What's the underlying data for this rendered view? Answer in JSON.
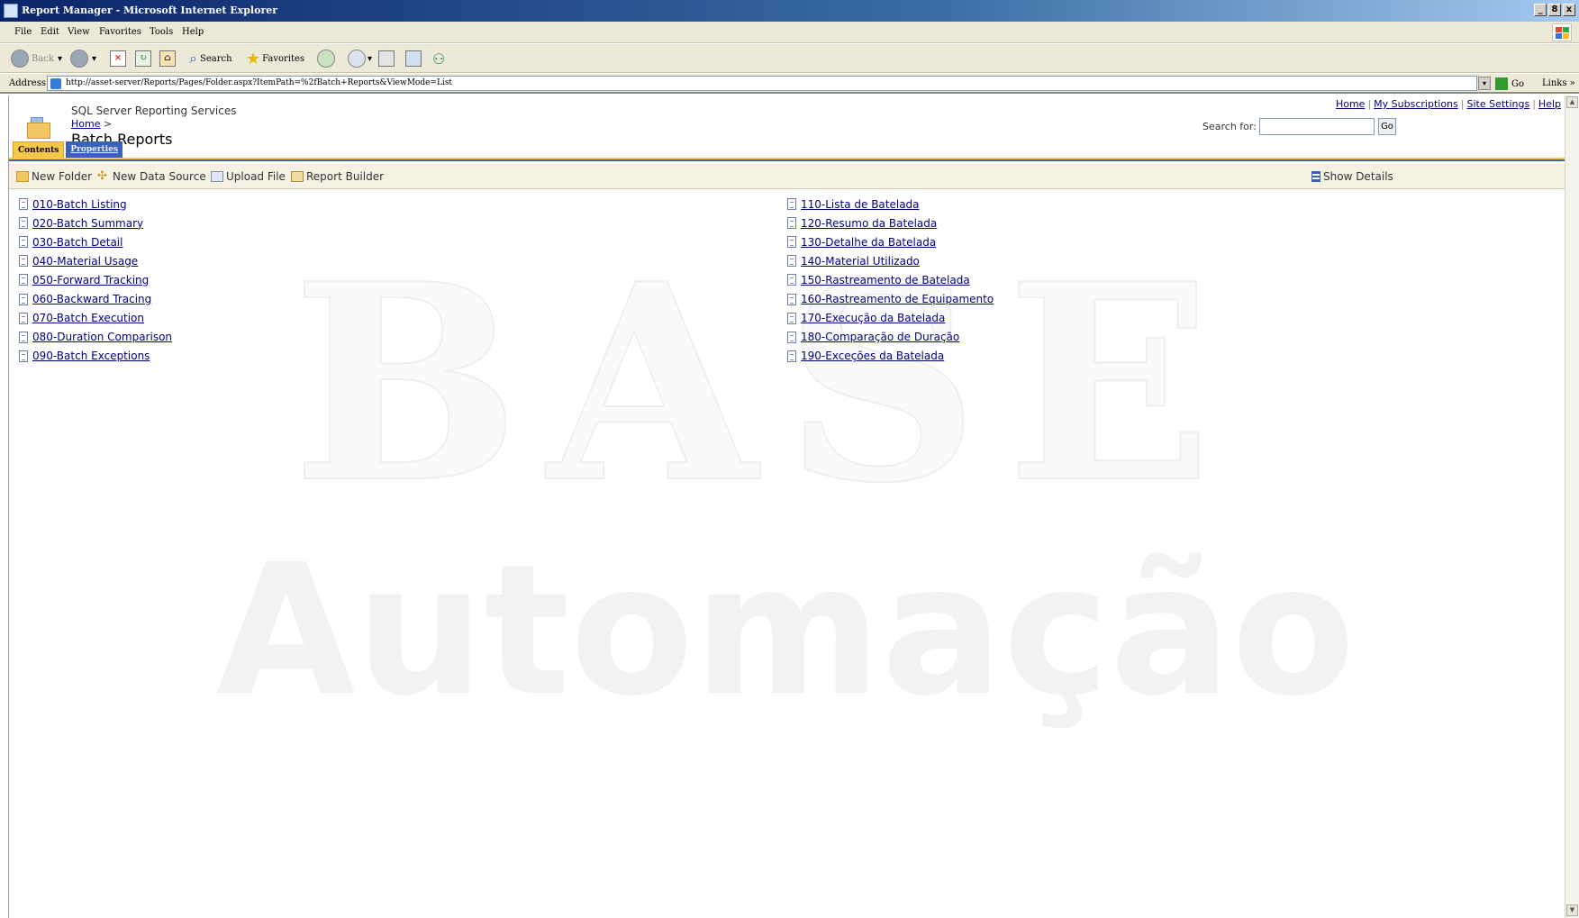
{
  "window": {
    "title": "Report Manager - Microsoft Internet Explorer",
    "controls": [
      "_",
      "8",
      "x"
    ]
  },
  "menu": [
    "File",
    "Edit",
    "View",
    "Favorites",
    "Tools",
    "Help"
  ],
  "toolbar": {
    "back": "Back",
    "search": "Search",
    "favorites": "Favorites"
  },
  "address": {
    "label": "Address",
    "url": "http://asset-server/Reports/Pages/Folder.aspx?ItemPath=%2fBatch+Reports&ViewMode=List",
    "go": "Go",
    "links": "Links »"
  },
  "header": {
    "product": "SQL Server Reporting Services",
    "breadcrumb_home": "Home",
    "breadcrumb_sep": ">",
    "title": "Batch Reports",
    "links": {
      "home": "Home",
      "subscriptions": "My Subscriptions",
      "settings": "Site Settings",
      "help": "Help"
    },
    "separator": "|",
    "search_label": "Search for:",
    "search_value": "",
    "go": "Go"
  },
  "tabs": {
    "contents": "Contents",
    "properties": "Properties"
  },
  "actions": {
    "new_folder": "New Folder",
    "new_data_source": "New Data Source",
    "upload_file": "Upload File",
    "report_builder": "Report Builder",
    "show_details": "Show Details"
  },
  "reports_left": [
    "010-Batch Listing",
    "020-Batch Summary",
    "030-Batch Detail",
    "040-Material Usage",
    "050-Forward Tracking",
    "060-Backward Tracing",
    "070-Batch Execution",
    "080-Duration Comparison",
    "090-Batch Exceptions"
  ],
  "reports_right": [
    "110-Lista de Batelada",
    "120-Resumo da Batelada",
    "130-Detalhe da Batelada",
    "140-Material Utilizado",
    "150-Rastreamento de Batelada",
    "160-Rastreamento de Equipamento",
    "170-Execução da Batelada",
    "180-Comparação de Duração",
    "190-Exceções da Batelada"
  ],
  "watermark": {
    "line1": "BASE",
    "line2": "Automação"
  }
}
